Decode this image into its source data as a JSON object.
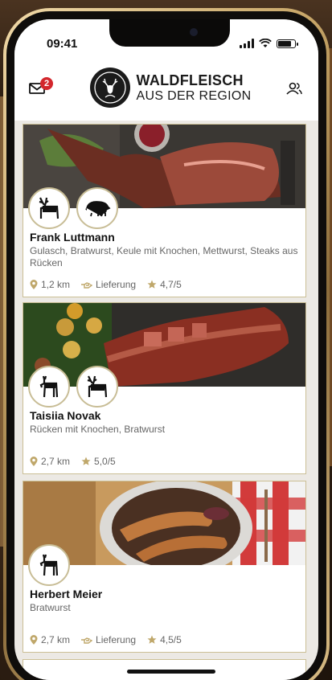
{
  "status": {
    "time": "09:41"
  },
  "header": {
    "mail_badge": "2",
    "logo_line1": "WALDFLEISCH",
    "logo_line2": "AUS DER REGION"
  },
  "vendors": [
    {
      "name": "Frank Luttmann",
      "cuts": "Gulasch, Bratwurst, Keule mit Knochen, Mettwurst, Steaks aus Rücken",
      "animals": [
        "deer-icon",
        "boar-icon"
      ],
      "distance": "1,2 km",
      "delivery": "Lieferung",
      "rating": "4,7/5"
    },
    {
      "name": "Taisiia Novak",
      "cuts": "Rücken mit Knochen, Bratwurst",
      "animals": [
        "roe-deer-icon",
        "red-deer-icon"
      ],
      "distance": "2,7 km",
      "rating": "5,0/5"
    },
    {
      "name": "Herbert Meier",
      "cuts": "Bratwurst",
      "animals": [
        "roe-deer-icon"
      ],
      "distance": "2,7 km",
      "delivery": "Lieferung",
      "rating": "4,5/5"
    }
  ],
  "colors": {
    "accent_gold": "#bfa76a",
    "badge_red": "#d3262c",
    "border": "#cbbf95"
  }
}
